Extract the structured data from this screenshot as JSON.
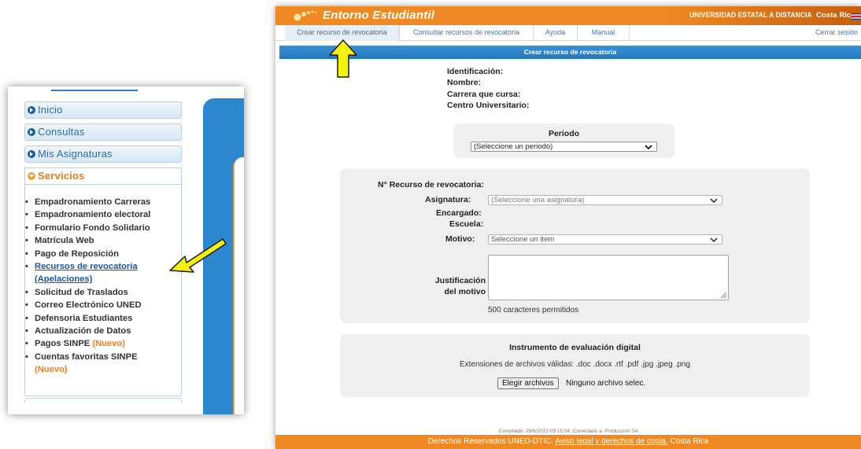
{
  "sidebar": {
    "menu": [
      {
        "label": "Inicio",
        "active": false
      },
      {
        "label": "Consultas",
        "active": false
      },
      {
        "label": "Mis Asignaturas",
        "active": false
      },
      {
        "label": "Servicios",
        "active": true
      }
    ],
    "services": [
      {
        "label": "Empadronamiento Carreras"
      },
      {
        "label": "Empadronamiento electoral"
      },
      {
        "label": "Formulario Fondo Solidario"
      },
      {
        "label": "Matrícula Web"
      },
      {
        "label": "Pago de Reposición"
      },
      {
        "label": "Recursos de revocatoria",
        "link": true
      },
      {
        "label": "(Apelaciones)",
        "link": true
      },
      {
        "label": "Solicitud de Traslados"
      },
      {
        "label": "Correo Electrónico UNED"
      },
      {
        "label": "Defensoria Estudiantes"
      },
      {
        "label": "Actualización de Datos"
      },
      {
        "label": "Pagos SINPE",
        "badge": "(Nuevo)"
      },
      {
        "label": "Cuentas favoritas SINPE"
      },
      {
        "label": "",
        "badge": "(Nuevo)"
      }
    ]
  },
  "header": {
    "app_title": "Entorno Estudiantil",
    "university": "UNIVERSIDAD ESTATAL A DISTANCIA",
    "country": "Costa Rica"
  },
  "nav": {
    "tabs": [
      {
        "label": "Crear recurso de revocatoria",
        "active": true
      },
      {
        "label": "Consultar recursos de revocatoria"
      },
      {
        "label": "Ayuda"
      },
      {
        "label": "Manual"
      }
    ],
    "logout": "Cerrar sesión"
  },
  "page": {
    "section_title": "Crear recurso de revocatoria",
    "info_labels": [
      "Identificación:",
      "Nombre:",
      "Carrera que cursa:",
      "Centro Universitario:"
    ],
    "periodo": {
      "label": "Periodo",
      "value": "(Seleccione un periodo)"
    },
    "recurso": {
      "number_label": "N° Recurso de revocatoria:",
      "asignatura_label": "Asignatura:",
      "asignatura_value": "(Seleccione una asignatura)",
      "encargado_label": "Encargado:",
      "escuela_label": "Escuela:",
      "motivo_label": "Motivo:",
      "motivo_value": "Seleccione un item",
      "justificacion_label_1": "Justificación",
      "justificacion_label_2": "del motivo",
      "chars_allowed": "500 caracteres permitidos"
    },
    "instrumento": {
      "title": "Instrumento de evaluación digital",
      "extensions": "Extensiones de archivos válidas: .doc .docx .rtf .pdf .jpg .jpeg .png",
      "button": "Elegir archivos",
      "status": "Ninguno archivo selec."
    }
  },
  "footer": {
    "compiled": "Compilado: 28/6/2022 09:15:04, Conectado a: Produccion S4",
    "rights": "Derechos Reservados UNED-DTIC.",
    "legal_link": "Aviso legal y derechos de copia.",
    "country": "Costa Rica"
  },
  "colors": {
    "header_orange": "#ef8a22",
    "bar_blue": "#2377bb",
    "arrow_yellow": "#f5f10a",
    "nuevo_orange": "#f07e1e",
    "link_blue": "#1a55a6"
  }
}
